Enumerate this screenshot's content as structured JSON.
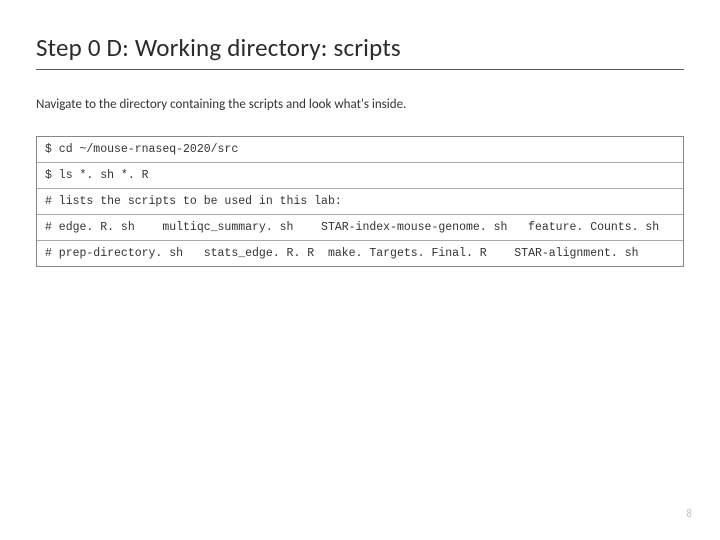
{
  "heading": "Step 0 D: Working directory: scripts",
  "intro": "Navigate to the directory containing the scripts and look what's inside.",
  "code": {
    "rows": [
      "$ cd ~/mouse-rnaseq-2020/src",
      "$ ls *. sh *. R",
      "# lists the scripts to be used in this lab:",
      "# edge. R. sh    multiqc_summary. sh    STAR-index-mouse-genome. sh   feature. Counts. sh",
      "# prep-directory. sh   stats_edge. R. R  make. Targets. Final. R    STAR-alignment. sh"
    ]
  },
  "page_number": "8"
}
